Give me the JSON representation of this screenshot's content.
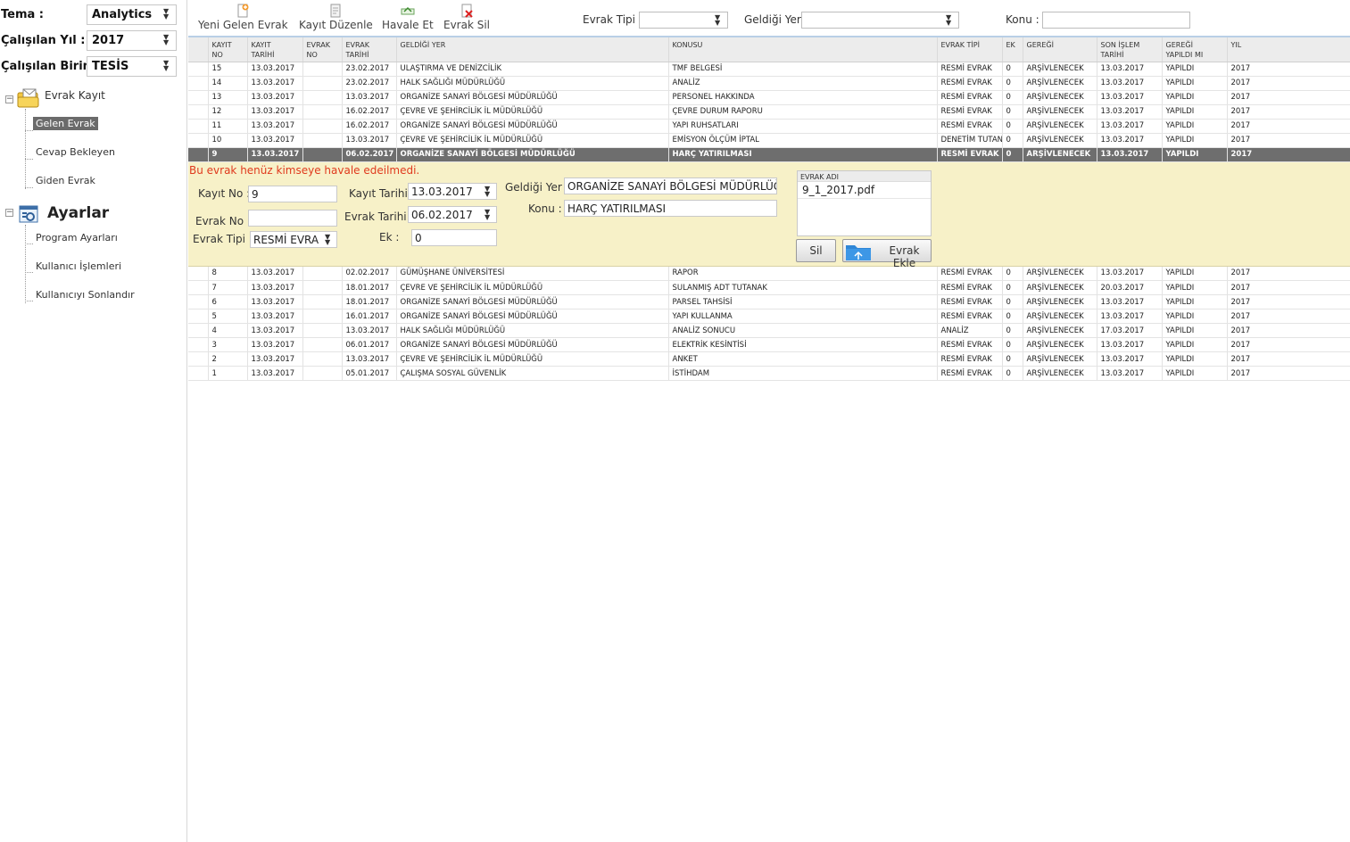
{
  "left": {
    "tema": {
      "label": "Tema :",
      "value": "Analytics"
    },
    "yil": {
      "label": "Çalışılan Yıl :",
      "value": "2017"
    },
    "birim": {
      "label": "Çalışılan Birim :",
      "value": "TESİS"
    },
    "tree": {
      "evrak_kayit": {
        "label": "Evrak Kayıt",
        "children": [
          "Gelen Evrak",
          "Cevap Bekleyen",
          "Giden Evrak"
        ]
      },
      "ayarlar": {
        "label": "Ayarlar",
        "children": [
          "Program Ayarları",
          "Kullanıcı İşlemleri",
          "Kullanıcıyı Sonlandır"
        ]
      }
    }
  },
  "toolbar": {
    "new_label": "Yeni Gelen Evrak",
    "edit_label": "Kayıt Düzenle",
    "forward_label": "Havale Et",
    "delete_label": "Evrak Sil",
    "filter_type_label": "Evrak Tipi :",
    "filter_source_label": "Geldiği Yer",
    "filter_subject_label": "Konu :"
  },
  "grid": {
    "headers": [
      [
        "KAYIT",
        "NO"
      ],
      [
        "KAYIT",
        "TARİHİ"
      ],
      [
        "EVRAK",
        "NO"
      ],
      [
        "EVRAK",
        "TARİHİ"
      ],
      [
        "GELDİĞİ YER",
        ""
      ],
      [
        "KONUSU",
        ""
      ],
      [
        "EVRAK TİPİ",
        ""
      ],
      [
        "EK",
        ""
      ],
      [
        "GEREĞİ",
        ""
      ],
      [
        "SON İŞLEM",
        "TARİHİ"
      ],
      [
        "GEREĞİ",
        "YAPILDI MI"
      ],
      [
        "YIL",
        ""
      ]
    ],
    "rows_top": [
      [
        "15",
        "13.03.2017",
        "",
        "23.02.2017",
        "ULAŞTIRMA VE DENİZCİLİK",
        "TMF BELGESİ",
        "RESMİ EVRAK",
        "0",
        "ARŞİVLENECEK",
        "13.03.2017",
        "YAPILDI",
        "2017"
      ],
      [
        "14",
        "13.03.2017",
        "",
        "23.02.2017",
        "HALK SAĞLIĞI MÜDÜRLÜĞÜ",
        "ANALİZ",
        "RESMİ EVRAK",
        "0",
        "ARŞİVLENECEK",
        "13.03.2017",
        "YAPILDI",
        "2017"
      ],
      [
        "13",
        "13.03.2017",
        "",
        "13.03.2017",
        "ORGANİZE SANAYİ BÖLGESİ MÜDÜRLÜĞÜ",
        "PERSONEL HAKKINDA",
        "RESMİ EVRAK",
        "0",
        "ARŞİVLENECEK",
        "13.03.2017",
        "YAPILDI",
        "2017"
      ],
      [
        "12",
        "13.03.2017",
        "",
        "16.02.2017",
        "ÇEVRE VE ŞEHİRCİLİK İL MÜDÜRLÜĞÜ",
        "ÇEVRE DURUM RAPORU",
        "RESMİ EVRAK",
        "0",
        "ARŞİVLENECEK",
        "13.03.2017",
        "YAPILDI",
        "2017"
      ],
      [
        "11",
        "13.03.2017",
        "",
        "16.02.2017",
        "ORGANİZE SANAYİ BÖLGESİ MÜDÜRLÜĞÜ",
        "YAPI RUHSATLARI",
        "RESMİ EVRAK",
        "0",
        "ARŞİVLENECEK",
        "13.03.2017",
        "YAPILDI",
        "2017"
      ],
      [
        "10",
        "13.03.2017",
        "",
        "13.03.2017",
        "ÇEVRE VE ŞEHİRCİLİK İL MÜDÜRLÜĞÜ",
        "EMİSYON ÖLÇÜM İPTAL",
        "DENETİM TUTAN",
        "0",
        "ARŞİVLENECEK",
        "13.03.2017",
        "YAPILDI",
        "2017"
      ]
    ],
    "row_selected": [
      "9",
      "13.03.2017",
      "",
      "06.02.2017",
      "ORGANİZE SANAYİ BÖLGESİ MÜDÜRLÜĞÜ",
      "HARÇ YATIRILMASI",
      "RESMİ EVRAK",
      "0",
      "ARŞİVLENECEK",
      "13.03.2017",
      "YAPILDI",
      "2017"
    ],
    "rows_bottom": [
      [
        "8",
        "13.03.2017",
        "",
        "02.02.2017",
        "GÜMÜŞHANE ÜNİVERSİTESİ",
        "RAPOR",
        "RESMİ EVRAK",
        "0",
        "ARŞİVLENECEK",
        "13.03.2017",
        "YAPILDI",
        "2017"
      ],
      [
        "7",
        "13.03.2017",
        "",
        "18.01.2017",
        "ÇEVRE VE ŞEHİRCİLİK İL MÜDÜRLÜĞÜ",
        "SULANMIŞ ADT TUTANAK",
        "RESMİ EVRAK",
        "0",
        "ARŞİVLENECEK",
        "20.03.2017",
        "YAPILDI",
        "2017"
      ],
      [
        "6",
        "13.03.2017",
        "",
        "18.01.2017",
        "ORGANİZE SANAYİ BÖLGESİ MÜDÜRLÜĞÜ",
        "PARSEL TAHSİSİ",
        "RESMİ EVRAK",
        "0",
        "ARŞİVLENECEK",
        "13.03.2017",
        "YAPILDI",
        "2017"
      ],
      [
        "5",
        "13.03.2017",
        "",
        "16.01.2017",
        "ORGANİZE SANAYİ BÖLGESİ MÜDÜRLÜĞÜ",
        "YAPI KULLANMA",
        "RESMİ EVRAK",
        "0",
        "ARŞİVLENECEK",
        "13.03.2017",
        "YAPILDI",
        "2017"
      ],
      [
        "4",
        "13.03.2017",
        "",
        "13.03.2017",
        "HALK SAĞLIĞI MÜDÜRLÜĞÜ",
        "ANALİZ SONUCU",
        "ANALİZ",
        "0",
        "ARŞİVLENECEK",
        "17.03.2017",
        "YAPILDI",
        "2017"
      ],
      [
        "3",
        "13.03.2017",
        "",
        "06.01.2017",
        "ORGANİZE SANAYİ BÖLGESİ MÜDÜRLÜĞÜ",
        "ELEKTRİK KESİNTİSİ",
        "RESMİ EVRAK",
        "0",
        "ARŞİVLENECEK",
        "13.03.2017",
        "YAPILDI",
        "2017"
      ],
      [
        "2",
        "13.03.2017",
        "",
        "13.03.2017",
        "ÇEVRE VE ŞEHİRCİLİK İL MÜDÜRLÜĞÜ",
        "ANKET",
        "RESMİ EVRAK",
        "0",
        "ARŞİVLENECEK",
        "13.03.2017",
        "YAPILDI",
        "2017"
      ],
      [
        "1",
        "13.03.2017",
        "",
        "05.01.2017",
        "ÇALIŞMA SOSYAL GÜVENLİK",
        "İSTİHDAM",
        "RESMİ EVRAK",
        "0",
        "ARŞİVLENECEK",
        "13.03.2017",
        "YAPILDI",
        "2017"
      ]
    ]
  },
  "detail": {
    "warning": "Bu evrak henüz kimseye havale edeilmedi.",
    "kayit_no": {
      "label": "Kayıt No :",
      "value": "9"
    },
    "evrak_no": {
      "label": "Evrak No :",
      "value": ""
    },
    "evrak_tipi": {
      "label": "Evrak Tipi :",
      "value": "RESMİ EVRA"
    },
    "kayit_tarihi": {
      "label": "Kayıt Tarihi :",
      "value": "13.03.2017"
    },
    "evrak_tarihi": {
      "label": "Evrak Tarihi :",
      "value": "06.02.2017"
    },
    "ek": {
      "label": "Ek :",
      "value": "0"
    },
    "geldigi_yer": {
      "label": "Geldiği Yer :",
      "value": "ORGANİZE SANAYİ BÖLGESİ MÜDÜRLÜĞÜ"
    },
    "konu": {
      "label": "Konu :",
      "value": "HARÇ YATIRILMASI"
    },
    "files": {
      "header": "EVRAK ADI",
      "items": [
        "9_1_2017.pdf"
      ]
    },
    "delete_label": "Sil",
    "add_label": "Evrak Ekle"
  },
  "colors": {
    "selected_row": "#6e6e6e",
    "detail_bg": "#f7f1c8",
    "warning": "#e03a1e",
    "toolbar_border": "#b9cfe6"
  }
}
